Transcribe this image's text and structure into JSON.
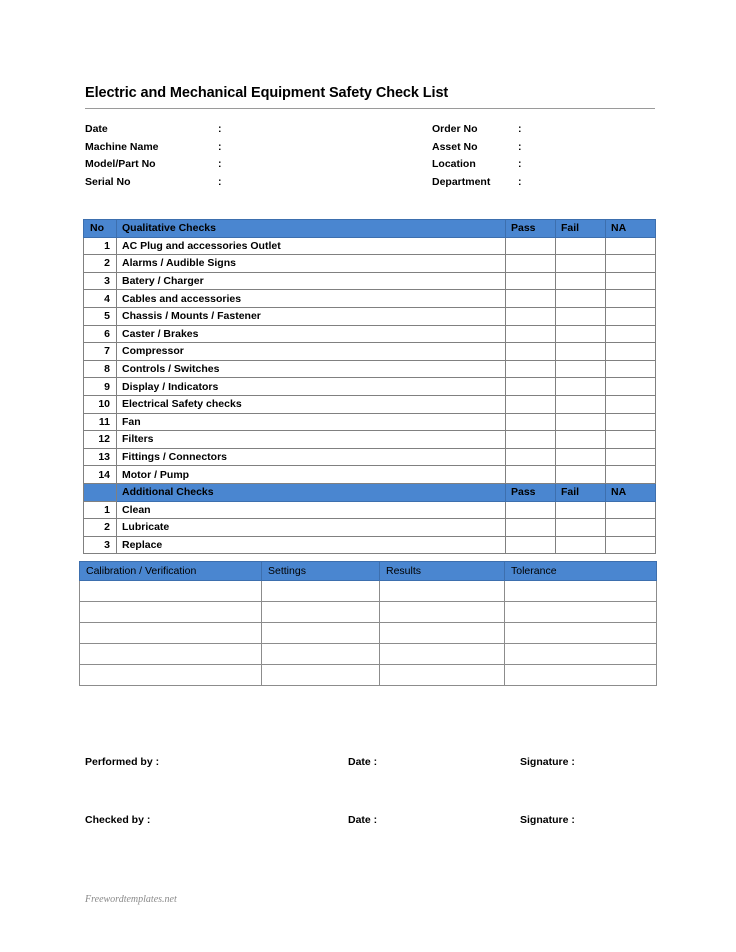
{
  "document": {
    "title": "Electric and Mechanical Equipment Safety Check List",
    "watermark": "Freewordtemplates.net"
  },
  "meta": {
    "left_fields": [
      {
        "label": "Date",
        "colon": ":",
        "value": ""
      },
      {
        "label": "Machine Name",
        "colon": ":",
        "value": ""
      },
      {
        "label": "Model/Part No",
        "colon": ":",
        "value": ""
      },
      {
        "label": "Serial No",
        "colon": ":",
        "value": ""
      }
    ],
    "right_fields": [
      {
        "label": "Order No",
        "colon": ":",
        "value": ""
      },
      {
        "label": "Asset No",
        "colon": ":",
        "value": ""
      },
      {
        "label": "Location",
        "colon": ":",
        "value": ""
      },
      {
        "label": "Department",
        "colon": ":",
        "value": ""
      }
    ]
  },
  "checks_table": {
    "headers": {
      "no": "No",
      "description": "Qualitative Checks",
      "pass": "Pass",
      "fail": "Fail",
      "na": "NA"
    },
    "rows": [
      {
        "no": "1",
        "description": "AC Plug and accessories Outlet",
        "pass": "",
        "fail": "",
        "na": ""
      },
      {
        "no": "2",
        "description": "Alarms / Audible Signs",
        "pass": "",
        "fail": "",
        "na": ""
      },
      {
        "no": "3",
        "description": "Batery / Charger",
        "pass": "",
        "fail": "",
        "na": ""
      },
      {
        "no": "4",
        "description": "Cables and accessories",
        "pass": "",
        "fail": "",
        "na": ""
      },
      {
        "no": "5",
        "description": "Chassis / Mounts / Fastener",
        "pass": "",
        "fail": "",
        "na": ""
      },
      {
        "no": "6",
        "description": "Caster / Brakes",
        "pass": "",
        "fail": "",
        "na": ""
      },
      {
        "no": "7",
        "description": "Compressor",
        "pass": "",
        "fail": "",
        "na": ""
      },
      {
        "no": "8",
        "description": "Controls / Switches",
        "pass": "",
        "fail": "",
        "na": ""
      },
      {
        "no": "9",
        "description": "Display / Indicators",
        "pass": "",
        "fail": "",
        "na": ""
      },
      {
        "no": "10",
        "description": "Electrical Safety checks",
        "pass": "",
        "fail": "",
        "na": ""
      },
      {
        "no": "11",
        "description": "Fan",
        "pass": "",
        "fail": "",
        "na": ""
      },
      {
        "no": "12",
        "description": "Filters",
        "pass": "",
        "fail": "",
        "na": ""
      },
      {
        "no": "13",
        "description": "Fittings / Connectors",
        "pass": "",
        "fail": "",
        "na": ""
      },
      {
        "no": "14",
        "description": "Motor / Pump",
        "pass": "",
        "fail": "",
        "na": ""
      }
    ],
    "additional_headers": {
      "no": "",
      "description": "Additional Checks",
      "pass": "Pass",
      "fail": "Fail",
      "na": "NA"
    },
    "additional_rows": [
      {
        "no": "1",
        "description": "Clean",
        "pass": "",
        "fail": "",
        "na": ""
      },
      {
        "no": "2",
        "description": "Lubricate",
        "pass": "",
        "fail": "",
        "na": ""
      },
      {
        "no": "3",
        "description": "Replace",
        "pass": "",
        "fail": "",
        "na": ""
      }
    ]
  },
  "calibration_table": {
    "headers": {
      "c1": "Calibration / Verification",
      "c2": "Settings",
      "c3": "Results",
      "c4": "Tolerance"
    },
    "rows": [
      {
        "c1": "",
        "c2": "",
        "c3": "",
        "c4": ""
      },
      {
        "c1": "",
        "c2": "",
        "c3": "",
        "c4": ""
      },
      {
        "c1": "",
        "c2": "",
        "c3": "",
        "c4": ""
      },
      {
        "c1": "",
        "c2": "",
        "c3": "",
        "c4": ""
      },
      {
        "c1": "",
        "c2": "",
        "c3": "",
        "c4": ""
      }
    ]
  },
  "signatures": {
    "performed": {
      "role": "Performed by :",
      "date": "Date :",
      "signature": "Signature :"
    },
    "checked": {
      "role": "Checked by :",
      "date": "Date :",
      "signature": "Signature :"
    }
  },
  "colors": {
    "header_blue": "#4a86d0",
    "border_gray": "#808080",
    "watermark_gray": "#8a8a8a"
  }
}
